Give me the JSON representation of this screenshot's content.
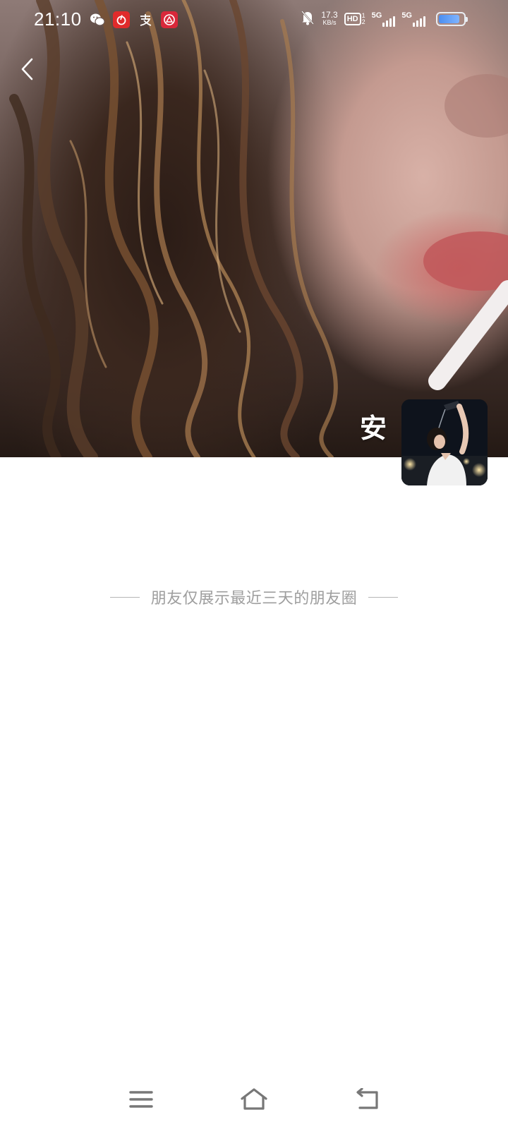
{
  "status_bar": {
    "time": "21:10",
    "notification_icons": [
      "wechat-icon",
      "netease-music-icon",
      "alipay-icon",
      "bank-app-icon"
    ],
    "silent_icon": "bell-off-icon",
    "network_speed": "17.3",
    "network_speed_unit": "KB/s",
    "hd_label": "HD",
    "hd_sims": [
      "1",
      "2"
    ],
    "signal_1": "5G",
    "signal_2": "5G",
    "battery_level": 0.85,
    "battery_color": "#4c8ef0"
  },
  "header": {
    "back_icon": "chevron-left-icon"
  },
  "profile": {
    "name": "安",
    "avatar": "user-avatar-photo"
  },
  "feed": {
    "notice": "朋友仅展示最近三天的朋友圈"
  },
  "nav_bar": {
    "menu_icon": "menu-icon",
    "home_icon": "home-icon",
    "back_icon": "back-arrow-icon"
  },
  "colors": {
    "notice_text": "#9e9e9e",
    "background": "#ffffff"
  }
}
